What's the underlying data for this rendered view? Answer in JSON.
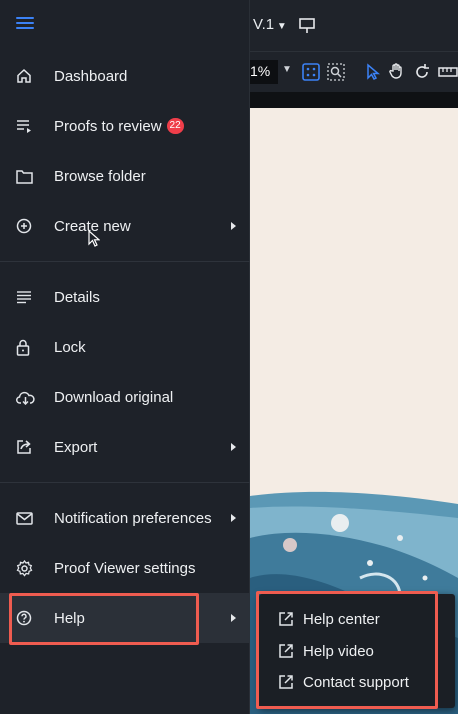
{
  "toolbar": {
    "version_label": "V.1",
    "zoom_value": "1%"
  },
  "menu": {
    "items": [
      {
        "label": "Dashboard",
        "icon": "home-icon"
      },
      {
        "label": "Proofs to review",
        "icon": "list-icon",
        "badge": "22"
      },
      {
        "label": "Browse folder",
        "icon": "folder-icon"
      },
      {
        "label": "Create new",
        "icon": "plus-circle-icon",
        "has_submenu": true
      },
      {
        "label": "Details",
        "icon": "details-lines-icon"
      },
      {
        "label": "Lock",
        "icon": "lock-icon"
      },
      {
        "label": "Download original",
        "icon": "cloud-download-icon"
      },
      {
        "label": "Export",
        "icon": "export-icon",
        "has_submenu": true
      },
      {
        "label": "Notification preferences",
        "icon": "mail-icon",
        "has_submenu": true
      },
      {
        "label": "Proof Viewer settings",
        "icon": "gear-icon"
      },
      {
        "label": "Help",
        "icon": "help-circle-icon",
        "has_submenu": true
      }
    ]
  },
  "help_submenu": {
    "items": [
      {
        "label": "Help center",
        "icon": "external-link-icon"
      },
      {
        "label": "Help video",
        "icon": "external-link-icon"
      },
      {
        "label": "Contact support",
        "icon": "external-link-icon"
      }
    ]
  },
  "colors": {
    "menu_bg": "#1e2229",
    "accent": "#3b82f6",
    "badge": "#ef3e4a",
    "highlight_box": "#ef5c50",
    "canvas": "#f4ece4"
  }
}
